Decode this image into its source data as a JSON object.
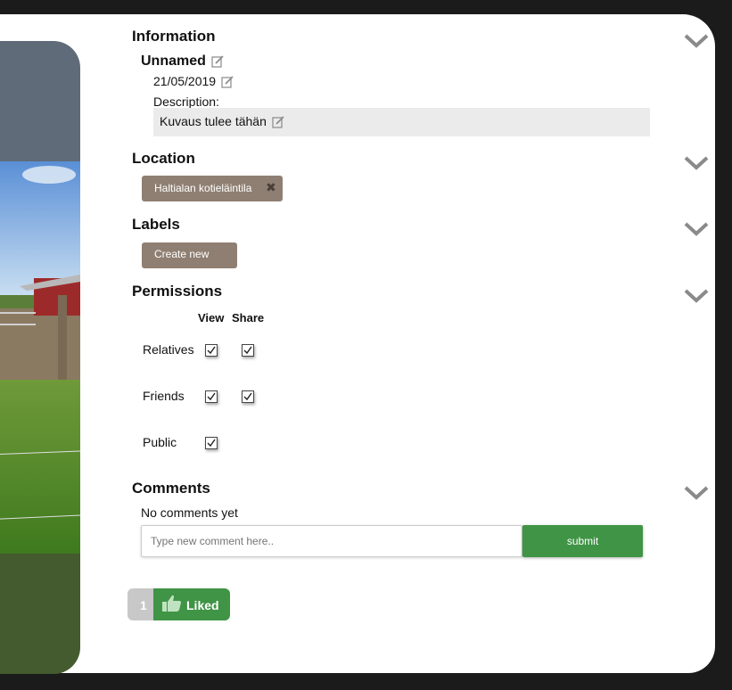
{
  "information": {
    "title": "Information",
    "name": "Unnamed",
    "date": "21/05/2019",
    "description_label": "Description:",
    "description_value": "Kuvaus tulee tähän"
  },
  "location": {
    "title": "Location",
    "tag": "Haltialan kotieläintila"
  },
  "labels": {
    "title": "Labels",
    "create_button": "Create new"
  },
  "permissions": {
    "title": "Permissions",
    "columns": [
      "View",
      "Share"
    ],
    "rows": [
      {
        "label": "Relatives",
        "view": true,
        "share": true
      },
      {
        "label": "Friends",
        "view": true,
        "share": true
      },
      {
        "label": "Public",
        "view": true,
        "share": null
      }
    ]
  },
  "comments": {
    "title": "Comments",
    "empty_text": "No comments yet",
    "placeholder": "Type new comment here..",
    "submit_label": "submit"
  },
  "likes": {
    "count": "1",
    "label": "Liked"
  },
  "colors": {
    "accent_green": "#409446",
    "tag_brown": "#8f7f72",
    "description_bg": "#ebebeb"
  }
}
